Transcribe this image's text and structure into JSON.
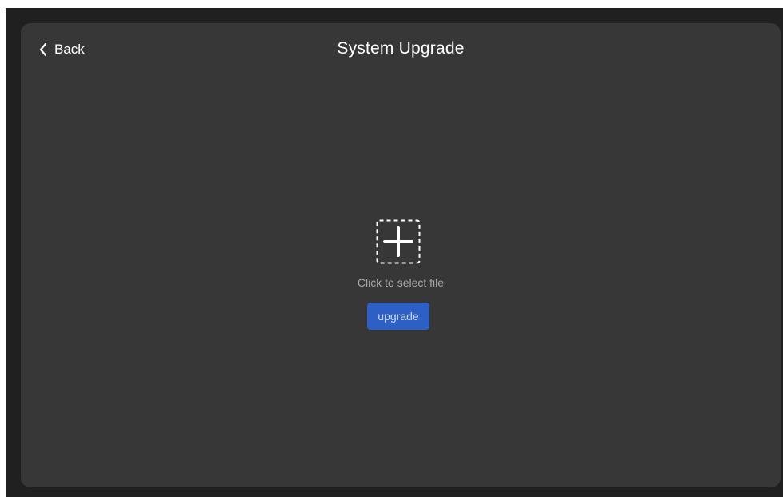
{
  "header": {
    "back_label": "Back",
    "title": "System Upgrade"
  },
  "upload": {
    "icon": "add-file-icon",
    "hint": "Click to select file"
  },
  "actions": {
    "upgrade_label": "upgrade"
  },
  "colors": {
    "outer_background": "#202020",
    "panel_background": "#373737",
    "accent": "#2d5fc4",
    "text_primary": "#ffffff",
    "text_muted": "#a6a6a6"
  }
}
